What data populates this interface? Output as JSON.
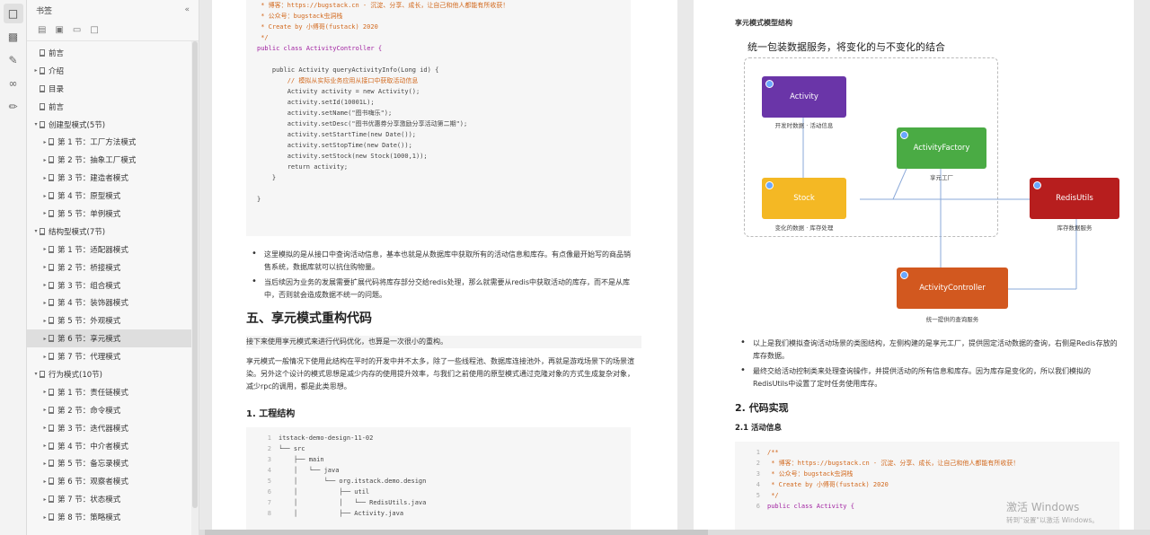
{
  "panel": {
    "title": "书签",
    "tree": [
      {
        "label": "前言",
        "level": 0,
        "twisty": ""
      },
      {
        "label": "介绍",
        "level": 0,
        "twisty": "▸"
      },
      {
        "label": "目录",
        "level": 0,
        "twisty": ""
      },
      {
        "label": "前言",
        "level": 0,
        "twisty": ""
      },
      {
        "label": "创建型模式(5节)",
        "level": 0,
        "twisty": "▾"
      },
      {
        "label": "第 1 节：工厂方法模式",
        "level": 1,
        "twisty": "▸"
      },
      {
        "label": "第 2 节：抽象工厂模式",
        "level": 1,
        "twisty": "▸"
      },
      {
        "label": "第 3 节：建造者模式",
        "level": 1,
        "twisty": "▸"
      },
      {
        "label": "第 4 节：原型模式",
        "level": 1,
        "twisty": "▸"
      },
      {
        "label": "第 5 节：单例模式",
        "level": 1,
        "twisty": "▸"
      },
      {
        "label": "结构型模式(7节)",
        "level": 0,
        "twisty": "▾"
      },
      {
        "label": "第 1 节：适配器模式",
        "level": 1,
        "twisty": "▸"
      },
      {
        "label": "第 2 节：桥接模式",
        "level": 1,
        "twisty": "▸"
      },
      {
        "label": "第 3 节：组合模式",
        "level": 1,
        "twisty": "▸"
      },
      {
        "label": "第 4 节：装饰器模式",
        "level": 1,
        "twisty": "▸"
      },
      {
        "label": "第 5 节：外观模式",
        "level": 1,
        "twisty": "▸"
      },
      {
        "label": "第 6 节：享元模式",
        "level": 1,
        "twisty": "▸",
        "selected": true
      },
      {
        "label": "第 7 节：代理模式",
        "level": 1,
        "twisty": "▸"
      },
      {
        "label": "行为模式(10节)",
        "level": 0,
        "twisty": "▾"
      },
      {
        "label": "第 1 节：责任链模式",
        "level": 1,
        "twisty": "▸"
      },
      {
        "label": "第 2 节：命令模式",
        "level": 1,
        "twisty": "▸"
      },
      {
        "label": "第 3 节：迭代器模式",
        "level": 1,
        "twisty": "▸"
      },
      {
        "label": "第 4 节：中介者模式",
        "level": 1,
        "twisty": "▸"
      },
      {
        "label": "第 5 节：备忘录模式",
        "level": 1,
        "twisty": "▸"
      },
      {
        "label": "第 6 节：观察者模式",
        "level": 1,
        "twisty": "▸"
      },
      {
        "label": "第 7 节：状态模式",
        "level": 1,
        "twisty": "▸"
      },
      {
        "label": "第 8 节：策略模式",
        "level": 1,
        "twisty": "▸"
      }
    ]
  },
  "page1": {
    "code_lines": [
      {
        "n": "",
        "text": " * 博客：https://bugstack.cn - 沉淀、分享、成长，让自己和他人都能有所收获！",
        "cls": "cm"
      },
      {
        "n": "",
        "text": " * 公众号：bugstack虫洞栈",
        "cls": "cm"
      },
      {
        "n": "",
        "text": " * Create by 小傅哥(fustack) 2020",
        "cls": "cm"
      },
      {
        "n": "",
        "text": " */",
        "cls": "cm"
      },
      {
        "n": "",
        "text": "public class ActivityController {",
        "cls": "kw"
      },
      {
        "n": "",
        "text": "",
        "cls": ""
      },
      {
        "n": "",
        "text": "    public Activity queryActivityInfo(Long id) {",
        "cls": ""
      },
      {
        "n": "",
        "text": "        // 模拟从实际业务应用从接口中获取活动信息",
        "cls": "cm"
      },
      {
        "n": "",
        "text": "        Activity activity = new Activity();",
        "cls": ""
      },
      {
        "n": "",
        "text": "        activity.setId(10001L);",
        "cls": ""
      },
      {
        "n": "",
        "text": "        activity.setName(\"图书嗨乐\");",
        "cls": ""
      },
      {
        "n": "",
        "text": "        activity.setDesc(\"图书优惠券分享激励分享活动第二期\");",
        "cls": ""
      },
      {
        "n": "",
        "text": "        activity.setStartTime(new Date());",
        "cls": ""
      },
      {
        "n": "",
        "text": "        activity.setStopTime(new Date());",
        "cls": ""
      },
      {
        "n": "",
        "text": "        activity.setStock(new Stock(1000,1));",
        "cls": ""
      },
      {
        "n": "",
        "text": "        return activity;",
        "cls": ""
      },
      {
        "n": "",
        "text": "    }",
        "cls": ""
      },
      {
        "n": "",
        "text": "",
        "cls": ""
      },
      {
        "n": "",
        "text": "}",
        "cls": ""
      }
    ],
    "bullets": [
      "这里模拟的是从接口中查询活动信息，基本也就是从数据库中获取所有的活动信息和库存。有点像最开始写的商品销售系统，数据库就可以抗住购物量。",
      "当后续因为业务的发展需要扩展代码将库存部分交给redis处理，那么就需要从redis中获取活动的库存，而不是从库中，否则就会造成数据不统一的问题。"
    ],
    "h2": "五、享元模式重构代码",
    "intro": "接下来使用享元模式来进行代码优化，也算是一次很小的重构。",
    "para": "享元模式一般情况下使用此结构在平时的开发中并不太多，除了一些线程池、数据库连接池外，再就是游戏场景下的场景渲染。另外这个设计的模式思想是减少内存的使用提升效率，与我们之前使用的原型模式通过克隆对象的方式生成复杂对象，减少rpc的调用，都是此类思想。",
    "h3": "1. 工程结构",
    "tree_lines": [
      {
        "n": "1",
        "text": "itstack-demo-design-11-02"
      },
      {
        "n": "2",
        "text": "└── src"
      },
      {
        "n": "3",
        "text": "    ├── main"
      },
      {
        "n": "4",
        "text": "    │   └── java"
      },
      {
        "n": "5",
        "text": "    │       └── org.itstack.demo.design"
      },
      {
        "n": "6",
        "text": "    │           ├── util"
      },
      {
        "n": "7",
        "text": "    │           │   └── RedisUtils.java"
      },
      {
        "n": "8",
        "text": "    │           ├── Activity.java"
      }
    ]
  },
  "page2": {
    "top_label": "享元模式模型结构",
    "diagram_title": "统一包装数据服务，将变化的与不变化的结合",
    "boxes": {
      "activity": "Activity",
      "activity_cap": "开发时数据 · 活动信息",
      "factory": "ActivityFactory",
      "factory_cap": "享元工厂",
      "stock": "Stock",
      "stock_cap": "变化的数据 · 库存处理",
      "redis": "RedisUtils",
      "redis_cap": "库存数据服务",
      "controller": "ActivityController",
      "controller_cap": "统一提供的查询服务"
    },
    "colors": {
      "activity": "#6a35a8",
      "factory": "#4aab44",
      "stock": "#f4b824",
      "redis": "#b71e1e",
      "controller": "#d2581f"
    },
    "bullets": [
      "以上是我们模拟查询活动场景的类图结构，左侧构建的是享元工厂，提供固定活动数据的查询，右侧是Redis存放的库存数据。",
      "最终交给活动控制类来处理查询操作，并提供活动的所有信息和库存。因为库存是变化的，所以我们模拟的RedisUtils中设置了定时任务使用库存。"
    ],
    "h2": "2. 代码实现",
    "h3": "2.1 活动信息",
    "code_lines": [
      {
        "n": "1",
        "text": "/**",
        "cls": "cm"
      },
      {
        "n": "2",
        "text": " * 博客：https://bugstack.cn - 沉淀、分享、成长，让自己和他人都能有所收获！",
        "cls": "cm"
      },
      {
        "n": "3",
        "text": " * 公众号：bugstack虫洞栈",
        "cls": "cm"
      },
      {
        "n": "4",
        "text": " * Create by 小傅哥(fustack) 2020",
        "cls": "cm"
      },
      {
        "n": "5",
        "text": " */",
        "cls": "cm"
      },
      {
        "n": "6",
        "text": "public class Activity {",
        "cls": "kw"
      }
    ],
    "watermark_1": "激活 Windows",
    "watermark_2": "转到\"设置\"以激活 Windows。"
  }
}
